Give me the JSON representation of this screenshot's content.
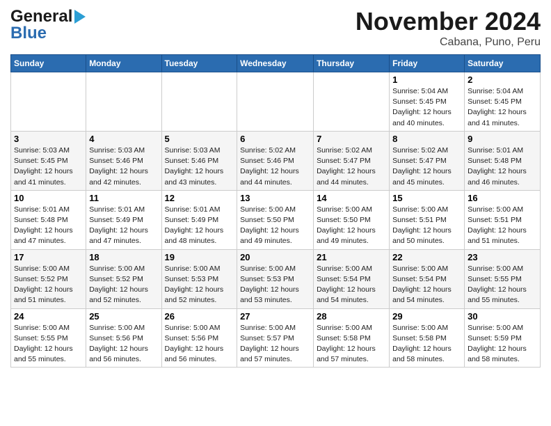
{
  "header": {
    "logo_line1": "General",
    "logo_line2": "Blue",
    "month": "November 2024",
    "location": "Cabana, Puno, Peru"
  },
  "weekdays": [
    "Sunday",
    "Monday",
    "Tuesday",
    "Wednesday",
    "Thursday",
    "Friday",
    "Saturday"
  ],
  "weeks": [
    [
      {
        "day": "",
        "content": ""
      },
      {
        "day": "",
        "content": ""
      },
      {
        "day": "",
        "content": ""
      },
      {
        "day": "",
        "content": ""
      },
      {
        "day": "",
        "content": ""
      },
      {
        "day": "1",
        "content": "Sunrise: 5:04 AM\nSunset: 5:45 PM\nDaylight: 12 hours\nand 40 minutes."
      },
      {
        "day": "2",
        "content": "Sunrise: 5:04 AM\nSunset: 5:45 PM\nDaylight: 12 hours\nand 41 minutes."
      }
    ],
    [
      {
        "day": "3",
        "content": "Sunrise: 5:03 AM\nSunset: 5:45 PM\nDaylight: 12 hours\nand 41 minutes."
      },
      {
        "day": "4",
        "content": "Sunrise: 5:03 AM\nSunset: 5:46 PM\nDaylight: 12 hours\nand 42 minutes."
      },
      {
        "day": "5",
        "content": "Sunrise: 5:03 AM\nSunset: 5:46 PM\nDaylight: 12 hours\nand 43 minutes."
      },
      {
        "day": "6",
        "content": "Sunrise: 5:02 AM\nSunset: 5:46 PM\nDaylight: 12 hours\nand 44 minutes."
      },
      {
        "day": "7",
        "content": "Sunrise: 5:02 AM\nSunset: 5:47 PM\nDaylight: 12 hours\nand 44 minutes."
      },
      {
        "day": "8",
        "content": "Sunrise: 5:02 AM\nSunset: 5:47 PM\nDaylight: 12 hours\nand 45 minutes."
      },
      {
        "day": "9",
        "content": "Sunrise: 5:01 AM\nSunset: 5:48 PM\nDaylight: 12 hours\nand 46 minutes."
      }
    ],
    [
      {
        "day": "10",
        "content": "Sunrise: 5:01 AM\nSunset: 5:48 PM\nDaylight: 12 hours\nand 47 minutes."
      },
      {
        "day": "11",
        "content": "Sunrise: 5:01 AM\nSunset: 5:49 PM\nDaylight: 12 hours\nand 47 minutes."
      },
      {
        "day": "12",
        "content": "Sunrise: 5:01 AM\nSunset: 5:49 PM\nDaylight: 12 hours\nand 48 minutes."
      },
      {
        "day": "13",
        "content": "Sunrise: 5:00 AM\nSunset: 5:50 PM\nDaylight: 12 hours\nand 49 minutes."
      },
      {
        "day": "14",
        "content": "Sunrise: 5:00 AM\nSunset: 5:50 PM\nDaylight: 12 hours\nand 49 minutes."
      },
      {
        "day": "15",
        "content": "Sunrise: 5:00 AM\nSunset: 5:51 PM\nDaylight: 12 hours\nand 50 minutes."
      },
      {
        "day": "16",
        "content": "Sunrise: 5:00 AM\nSunset: 5:51 PM\nDaylight: 12 hours\nand 51 minutes."
      }
    ],
    [
      {
        "day": "17",
        "content": "Sunrise: 5:00 AM\nSunset: 5:52 PM\nDaylight: 12 hours\nand 51 minutes."
      },
      {
        "day": "18",
        "content": "Sunrise: 5:00 AM\nSunset: 5:52 PM\nDaylight: 12 hours\nand 52 minutes."
      },
      {
        "day": "19",
        "content": "Sunrise: 5:00 AM\nSunset: 5:53 PM\nDaylight: 12 hours\nand 52 minutes."
      },
      {
        "day": "20",
        "content": "Sunrise: 5:00 AM\nSunset: 5:53 PM\nDaylight: 12 hours\nand 53 minutes."
      },
      {
        "day": "21",
        "content": "Sunrise: 5:00 AM\nSunset: 5:54 PM\nDaylight: 12 hours\nand 54 minutes."
      },
      {
        "day": "22",
        "content": "Sunrise: 5:00 AM\nSunset: 5:54 PM\nDaylight: 12 hours\nand 54 minutes."
      },
      {
        "day": "23",
        "content": "Sunrise: 5:00 AM\nSunset: 5:55 PM\nDaylight: 12 hours\nand 55 minutes."
      }
    ],
    [
      {
        "day": "24",
        "content": "Sunrise: 5:00 AM\nSunset: 5:55 PM\nDaylight: 12 hours\nand 55 minutes."
      },
      {
        "day": "25",
        "content": "Sunrise: 5:00 AM\nSunset: 5:56 PM\nDaylight: 12 hours\nand 56 minutes."
      },
      {
        "day": "26",
        "content": "Sunrise: 5:00 AM\nSunset: 5:56 PM\nDaylight: 12 hours\nand 56 minutes."
      },
      {
        "day": "27",
        "content": "Sunrise: 5:00 AM\nSunset: 5:57 PM\nDaylight: 12 hours\nand 57 minutes."
      },
      {
        "day": "28",
        "content": "Sunrise: 5:00 AM\nSunset: 5:58 PM\nDaylight: 12 hours\nand 57 minutes."
      },
      {
        "day": "29",
        "content": "Sunrise: 5:00 AM\nSunset: 5:58 PM\nDaylight: 12 hours\nand 58 minutes."
      },
      {
        "day": "30",
        "content": "Sunrise: 5:00 AM\nSunset: 5:59 PM\nDaylight: 12 hours\nand 58 minutes."
      }
    ]
  ]
}
